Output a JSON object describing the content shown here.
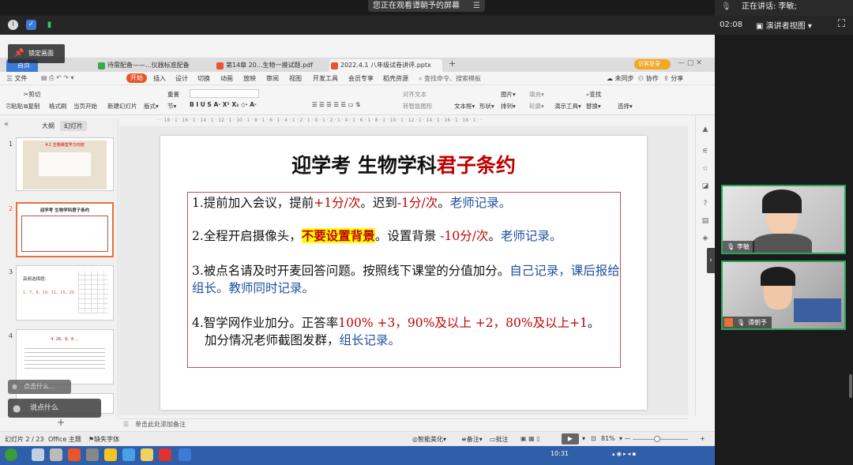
{
  "share_banner": "您正在观看谭朝予的屏幕",
  "speaking": "正在讲话: 李敏;",
  "meeting": {
    "timer": "02:08",
    "speaker_view": "演讲者视图"
  },
  "lock_screen": "锁定画面",
  "tabs": [
    {
      "label": "首页",
      "color": "#4a86e8"
    },
    {
      "label": "待需配备——...仪器标准配备",
      "color": "#34a853"
    },
    {
      "label": "第14章  20...生物一摸试题.pdf",
      "color": "#e8542c"
    },
    {
      "label": "2022.4.1 八年级试卷讲评.pptx",
      "color": "#e8542c"
    }
  ],
  "visitor_label": "访客登录",
  "menu": {
    "file": "三 文件",
    "start": "开始",
    "items": [
      "插入",
      "设计",
      "切换",
      "动画",
      "放映",
      "审阅",
      "视图",
      "开发工具",
      "会员专享",
      "稻壳资源"
    ],
    "search": "查找命令、搜索模板",
    "right": [
      "未同步",
      "协作",
      "分享"
    ]
  },
  "ribbon": {
    "paste": "粘贴",
    "cut": "剪切",
    "copy": "复制",
    "format_painter": "格式刷",
    "from_current": "当页开始",
    "new_slide": "新建幻灯片",
    "layout": "版式",
    "section": "节",
    "reset": "重置",
    "text_box": "文本框",
    "shape": "形状",
    "arrange": "排列",
    "picture": "图片",
    "fill": "填充",
    "outline": "轮廓",
    "present_tools": "演示工具",
    "find": "查找",
    "replace": "替换",
    "select": "选择",
    "convert_text": "对齐文本",
    "smart_graphic": "转智能图形"
  },
  "ruler": "· · 18 · 1 · 16 · 1 · 14 · 1 · 12 · 1 · 10 · 1 · 8 · 1 · 6 · 1 · 4 · 1 · 2 · 1 · 0 · 1 · 2 · 1 · 4 · 1 · 6 · 1 · 8 · 1 · 10 · 1 · 12 · 1 · 14 · 1 · 16 · 1 · 18 · 1 · ·",
  "left_panel": {
    "tab_outline": "大纲",
    "tab_slides": "幻灯片",
    "thumbs": [
      {
        "num": "1",
        "title": "4.1 生物课堂学习内容"
      },
      {
        "num": "2",
        "title": "迎学考 生物学科君子条约"
      },
      {
        "num": "3",
        "title": "高频选择题："
      },
      {
        "num": "4",
        "title": "4. 18、9、6 ..."
      }
    ],
    "thumb3_numbers": "1、7、8、10、11、15、20"
  },
  "slide": {
    "title_black": "迎学考  生物学科",
    "title_red": "君子条约",
    "rules": [
      {
        "a": "1.提前加入会议，提前",
        "b": "+1分/次",
        "c": "。迟到",
        "d": "-1分/次",
        "e": "。",
        "f": "老师记录。"
      },
      {
        "a": "2.全程开启摄像头，",
        "hl": "不要设置背景",
        "c": "。设置背景 ",
        "d": "-10分/次",
        "e": "。",
        "f": "老师记录。"
      },
      {
        "a": "3.被点名请及时开麦回答问题。按照线下课堂的分值加分。",
        "f": "自己记录，课后报给组长。教师同时记录。"
      },
      {
        "a": "4.智学网作业加分。正答率",
        "b": "100% +3，90%及以上 +2，80%及以上+1",
        "c": "。",
        "g": "加分情况老师截图发群，",
        "f": "组长记录。"
      }
    ]
  },
  "notes_placeholder": "单击此处添加备注",
  "status": {
    "slide_count": "幻灯片 2 / 23",
    "theme": "Office 主题",
    "missing_font": "缺失字体",
    "beautify": "智能美化",
    "notes": "备注",
    "comment": "批注",
    "zoom": "81%"
  },
  "chat_overlay": "点击什么...",
  "chat_overlay2": "说点什么",
  "videos": [
    {
      "name": "李敏"
    },
    {
      "name": "谭朝予"
    }
  ],
  "clock": "10:31"
}
